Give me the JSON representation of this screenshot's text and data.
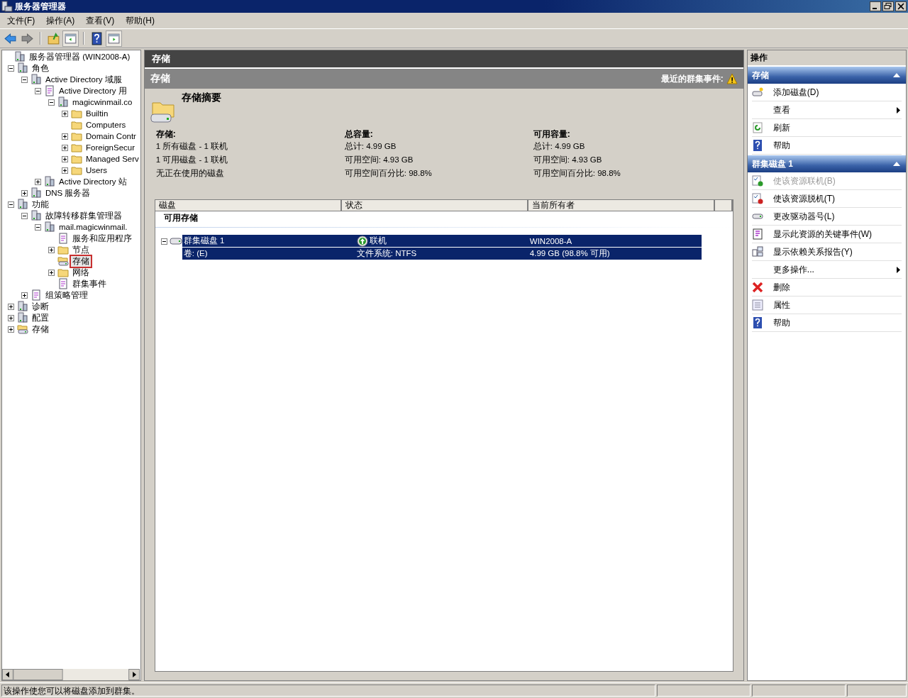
{
  "window": {
    "title": "服务器管理器"
  },
  "menu": [
    "文件(F)",
    "操作(A)",
    "查看(V)",
    "帮助(H)"
  ],
  "tree": [
    {
      "label": "服务器管理器 (WIN2008-A)",
      "kind": "computer",
      "selected": false,
      "children": [
        {
          "label": "角色",
          "kind": "computer",
          "expanded": true,
          "selected": false,
          "children": [
            {
              "label": "Active Directory 域服",
              "kind": "computer",
              "expanded": true,
              "selected": false,
              "children": [
                {
                  "label": "Active Directory 用",
                  "kind": "doc",
                  "expanded": true,
                  "selected": false,
                  "children": [
                    {
                      "label": "magicwinmail.co",
                      "kind": "computer",
                      "expanded": true,
                      "selected": false,
                      "children": [
                        {
                          "label": "Builtin",
                          "kind": "folder",
                          "expanded": false,
                          "selected": false
                        },
                        {
                          "label": "Computers",
                          "kind": "folder",
                          "selected": false
                        },
                        {
                          "label": "Domain Contr",
                          "kind": "folder",
                          "expanded": false,
                          "selected": false
                        },
                        {
                          "label": "ForeignSecur",
                          "kind": "folder",
                          "expanded": false,
                          "selected": false
                        },
                        {
                          "label": "Managed Serv",
                          "kind": "folder",
                          "expanded": false,
                          "selected": false
                        },
                        {
                          "label": "Users",
                          "kind": "folder",
                          "expanded": false,
                          "selected": false
                        }
                      ]
                    }
                  ]
                },
                {
                  "label": "Active Directory 站",
                  "kind": "computer",
                  "expanded": false,
                  "selected": false
                }
              ]
            },
            {
              "label": "DNS 服务器",
              "kind": "computer",
              "expanded": false,
              "selected": false
            }
          ]
        },
        {
          "label": "功能",
          "kind": "computer",
          "expanded": true,
          "selected": false,
          "children": [
            {
              "label": "故障转移群集管理器",
              "kind": "computer",
              "expanded": true,
              "selected": false,
              "children": [
                {
                  "label": "mail.magicwinmail.",
                  "kind": "computer",
                  "expanded": true,
                  "selected": false,
                  "children": [
                    {
                      "label": "服务和应用程序",
                      "kind": "doc",
                      "selected": false
                    },
                    {
                      "label": "节点",
                      "kind": "folder",
                      "expanded": false,
                      "selected": false
                    },
                    {
                      "label": "存储",
                      "kind": "storage",
                      "selected": true
                    },
                    {
                      "label": "网络",
                      "kind": "folder",
                      "expanded": false,
                      "selected": false
                    },
                    {
                      "label": "群集事件",
                      "kind": "doc",
                      "selected": false
                    }
                  ]
                }
              ]
            },
            {
              "label": "组策略管理",
              "kind": "doc",
              "expanded": false,
              "selected": false
            }
          ]
        },
        {
          "label": "诊断",
          "kind": "computer",
          "expanded": false,
          "selected": false
        },
        {
          "label": "配置",
          "kind": "computer",
          "expanded": false,
          "selected": false
        },
        {
          "label": "存储",
          "kind": "storage",
          "expanded": false,
          "selected": false
        }
      ]
    }
  ],
  "center": {
    "title": "存储",
    "header": "存储",
    "recent_events": "最近的群集事件:",
    "summary_title": "存储摘要",
    "summary": [
      {
        "heading": "存储:",
        "lines": [
          "1 所有磁盘 - 1 联机",
          "1 可用磁盘 - 1 联机",
          "无正在使用的磁盘"
        ]
      },
      {
        "heading": "总容量:",
        "lines": [
          "总计: 4.99 GB",
          "可用空间: 4.93 GB",
          "可用空间百分比: 98.8%"
        ]
      },
      {
        "heading": "可用容量:",
        "lines": [
          "总计: 4.99 GB",
          "可用空间: 4.93 GB",
          "可用空间百分比: 98.8%"
        ]
      }
    ],
    "table": {
      "columns": [
        "磁盘",
        "状态",
        "当前所有者"
      ],
      "group": "可用存储",
      "rows": [
        {
          "cells": [
            "群集磁盘 1",
            "联机",
            "WIN2008-A"
          ],
          "kind": "disk",
          "expanded": true,
          "selected": true
        },
        {
          "cells": [
            "卷: (E)",
            "文件系统: NTFS",
            "4.99 GB (98.8% 可用)"
          ],
          "kind": "volume",
          "selected": true
        }
      ]
    }
  },
  "actions": {
    "title": "操作",
    "sections": [
      {
        "title": "存储",
        "expanded": true,
        "items": [
          {
            "label": "添加磁盘(D)",
            "kind": "disk-add",
            "disabled": false,
            "submenu": false
          },
          {
            "label": "查看",
            "kind": "none",
            "disabled": false,
            "submenu": true
          },
          {
            "label": "刷新",
            "kind": "refresh",
            "disabled": false,
            "submenu": false
          },
          {
            "label": "帮助",
            "kind": "help",
            "disabled": false,
            "submenu": false
          }
        ]
      },
      {
        "title": "群集磁盘 1",
        "expanded": true,
        "items": [
          {
            "label": "使该资源联机(B)",
            "kind": "online",
            "disabled": true,
            "submenu": false
          },
          {
            "label": "使该资源脱机(T)",
            "kind": "offline",
            "disabled": false,
            "submenu": false
          },
          {
            "label": "更改驱动器号(L)",
            "kind": "drive",
            "disabled": false,
            "submenu": false
          },
          {
            "label": "显示此资源的关键事件(W)",
            "kind": "events",
            "disabled": false,
            "submenu": false
          },
          {
            "label": "显示依赖关系报告(Y)",
            "kind": "report",
            "disabled": false,
            "submenu": false
          },
          {
            "label": "更多操作...",
            "kind": "none",
            "disabled": false,
            "submenu": true
          },
          {
            "label": "删除",
            "kind": "delete",
            "disabled": false,
            "submenu": false
          },
          {
            "label": "属性",
            "kind": "properties",
            "disabled": false,
            "submenu": false
          },
          {
            "label": "帮助",
            "kind": "help",
            "disabled": false,
            "submenu": false
          }
        ]
      }
    ]
  },
  "status_bar": "该操作使您可以将磁盘添加到群集。"
}
